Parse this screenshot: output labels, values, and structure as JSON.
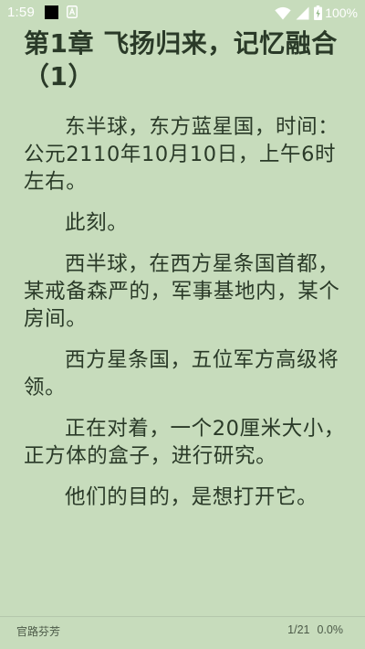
{
  "colors": {
    "background": "#c7dcbc",
    "text": "#2a3a28",
    "status_text": "#ffffff",
    "footer_text": "#4c5a48"
  },
  "status_bar": {
    "time": "1:59",
    "battery": "100%",
    "icons": [
      "notification-black-square-icon",
      "a-notification-icon",
      "wifi-icon",
      "cell-signal-icon",
      "battery-charging-icon"
    ]
  },
  "chapter": {
    "title": "第1章 飞扬归来，记忆融合（1）",
    "paragraphs": [
      "东半球，东方蓝星国，时间：公元2110年10月10日，上午6时左右。",
      "此刻。",
      "西半球，在西方星条国首都，某戒备森严的，军事基地内，某个房间。",
      "西方星条国，五位军方高级将领。",
      "正在对着，一个20厘米大小，正方体的盒子，进行研究。",
      "他们的目的，是想打开它。"
    ]
  },
  "footer": {
    "book_name": "官路芬芳",
    "page": "1/21",
    "progress": "0.0%"
  }
}
